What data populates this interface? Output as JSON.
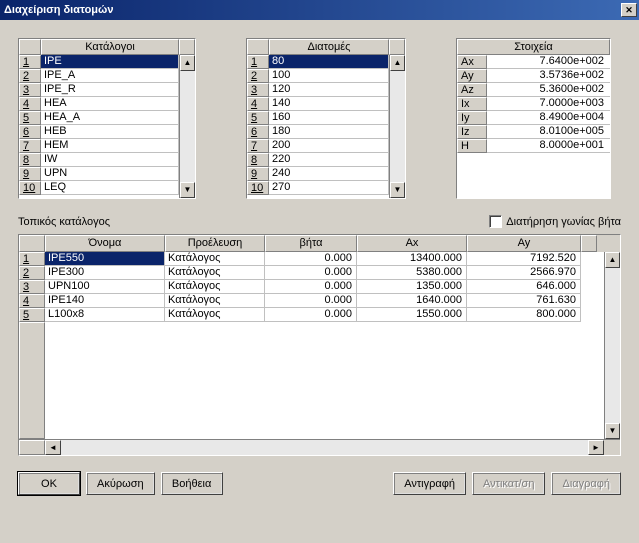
{
  "title": "Διαχείριση διατομών",
  "catalogs": {
    "header": "Κατάλογοι",
    "items": [
      "IPE",
      "IPE_A",
      "IPE_R",
      "HEA",
      "HEA_A",
      "HEB",
      "HEM",
      "IW",
      "UPN",
      "LEQ"
    ],
    "selected_index": 0
  },
  "sections": {
    "header": "Διατομές",
    "items": [
      "80",
      "100",
      "120",
      "140",
      "160",
      "180",
      "200",
      "220",
      "240",
      "270"
    ],
    "selected_index": 0
  },
  "properties": {
    "header": "Στοιχεία",
    "rows": [
      {
        "k": "Ax",
        "v": "7.6400e+002"
      },
      {
        "k": "Ay",
        "v": "3.5736e+002"
      },
      {
        "k": "Az",
        "v": "5.3600e+002"
      },
      {
        "k": "Ix",
        "v": "7.0000e+003"
      },
      {
        "k": "Iy",
        "v": "8.4900e+004"
      },
      {
        "k": "Iz",
        "v": "8.0100e+005"
      },
      {
        "k": "H",
        "v": "8.0000e+001"
      }
    ]
  },
  "local_catalog_label": "Τοπικός κατάλογος",
  "retain_beta_label": "Διατήρηση γωνίας βήτα",
  "grid": {
    "headers": [
      "Όνομα",
      "Προέλευση",
      "βήτα",
      "Ax",
      "Ay"
    ],
    "rows": [
      {
        "name": "IPE550",
        "origin": "Κατάλογος",
        "beta": "0.000",
        "ax": "13400.000",
        "ay": "7192.520",
        "selected": true
      },
      {
        "name": "IPE300",
        "origin": "Κατάλογος",
        "beta": "0.000",
        "ax": "5380.000",
        "ay": "2566.970"
      },
      {
        "name": "UPN100",
        "origin": "Κατάλογος",
        "beta": "0.000",
        "ax": "1350.000",
        "ay": "646.000"
      },
      {
        "name": "IPE140",
        "origin": "Κατάλογος",
        "beta": "0.000",
        "ax": "1640.000",
        "ay": "761.630"
      },
      {
        "name": "L100x8",
        "origin": "Κατάλογος",
        "beta": "0.000",
        "ax": "1550.000",
        "ay": "800.000"
      }
    ]
  },
  "buttons": {
    "ok": "OK",
    "cancel": "Ακύρωση",
    "help": "Βοήθεια",
    "copy": "Αντιγραφή",
    "replace": "Αντικατ/ση",
    "delete": "Διαγραφή"
  }
}
